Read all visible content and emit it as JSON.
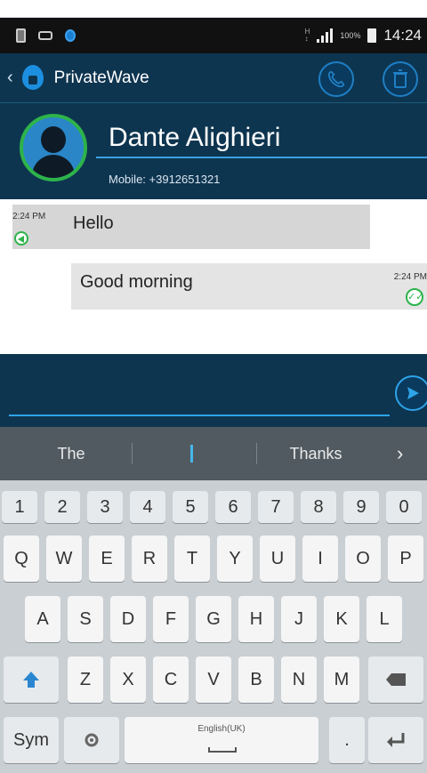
{
  "status_bar": {
    "battery_percent": "100%",
    "time": "14:24"
  },
  "app_bar": {
    "app_name": "PrivateWave"
  },
  "contact": {
    "name": "Dante Alighieri",
    "phone": "Mobile: +3912651321"
  },
  "messages": [
    {
      "direction": "incoming",
      "time": "2:24 PM",
      "text": "Hello"
    },
    {
      "direction": "outgoing",
      "time": "2:24 PM",
      "text": "Good morning"
    }
  ],
  "compose": {
    "value": ""
  },
  "suggestions": {
    "left": "The",
    "middle": "I",
    "right": "Thanks",
    "more": "›"
  },
  "keyboard": {
    "number_row": [
      "1",
      "2",
      "3",
      "4",
      "5",
      "6",
      "7",
      "8",
      "9",
      "0"
    ],
    "row1": [
      "Q",
      "W",
      "E",
      "R",
      "T",
      "Y",
      "U",
      "I",
      "O",
      "P"
    ],
    "row2": [
      "A",
      "S",
      "D",
      "F",
      "G",
      "H",
      "J",
      "K",
      "L"
    ],
    "row3": [
      "Z",
      "X",
      "C",
      "V",
      "B",
      "N",
      "M"
    ],
    "sym_label": "Sym",
    "space_label": "English(UK)",
    "period_label": ".",
    "colors": {
      "accent": "#2ea3e8",
      "header_bg": "#0e3550",
      "online": "#2db34a"
    }
  }
}
